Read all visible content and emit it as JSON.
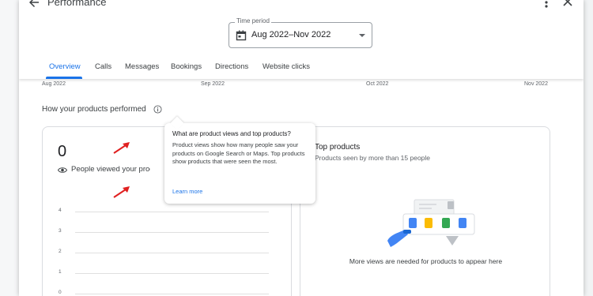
{
  "header": {
    "title": "Performance"
  },
  "time_period": {
    "label": "Time period",
    "value": "Aug 2022–Nov 2022"
  },
  "tabs": [
    {
      "label": "Overview",
      "active": true
    },
    {
      "label": "Calls"
    },
    {
      "label": "Messages"
    },
    {
      "label": "Bookings"
    },
    {
      "label": "Directions"
    },
    {
      "label": "Website clicks"
    }
  ],
  "timeline": [
    "Aug 2022",
    "Sep 2022",
    "Oct 2022",
    "Nov 2022"
  ],
  "products_section": {
    "title": "How your products performed"
  },
  "views_card": {
    "count": "0",
    "label": "People viewed your products",
    "y_ticks": [
      "4",
      "3",
      "2",
      "1",
      "0"
    ]
  },
  "top_products": {
    "title": "Top products",
    "subtitle": "Products seen by more than 15 people",
    "empty_message": "More views are needed for products to appear here"
  },
  "tooltip": {
    "title": "What are product views and top products?",
    "body": "Product views show how many people saw your products on Google Search or Maps. Top products show products that were seen the most.",
    "link": "Learn more"
  },
  "colors": {
    "accent": "#1a73e8",
    "annotation_arrow": "#e02020"
  }
}
